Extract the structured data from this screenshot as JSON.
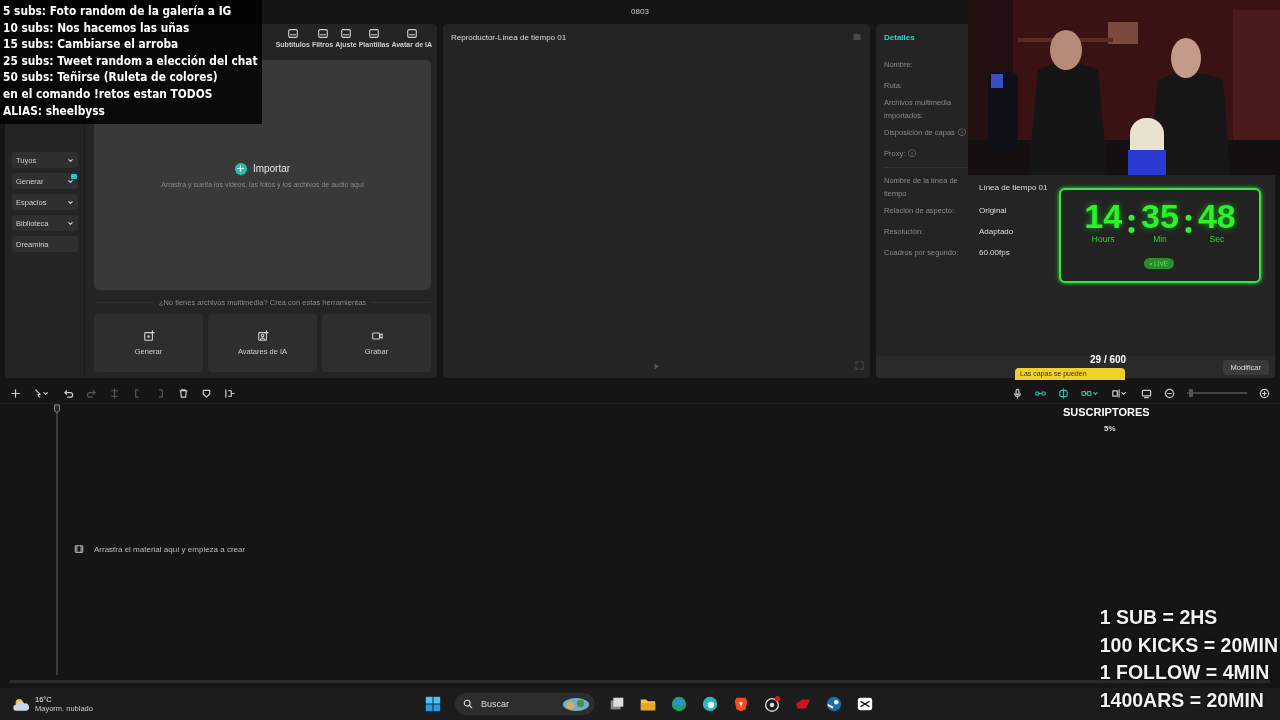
{
  "window": {
    "title": "0803"
  },
  "goals_overlay": {
    "lines": [
      "5 subs: Foto random de la galería a IG",
      "10 subs: Nos hacemos las uñas",
      "15 subs: Cambiarse el arroba",
      "25 subs: Tweet random a elección del chat",
      "50 subs: Teñirse (Ruleta de colores)",
      "en el comando !retos estan TODOS",
      "ALIAS: sheelbyss"
    ]
  },
  "media_panel": {
    "tabs": [
      {
        "label": "Subtítulos",
        "selected": false
      },
      {
        "label": "Filtros",
        "selected": false
      },
      {
        "label": "Ajuste",
        "selected": false
      },
      {
        "label": "Plantillas",
        "selected": false
      },
      {
        "label": "Avatar de IA",
        "selected": false
      }
    ],
    "sidebar": [
      {
        "label": "Tuyos",
        "expandable": true,
        "badge": false
      },
      {
        "label": "Generar",
        "expandable": true,
        "badge": true
      },
      {
        "label": "Espacios",
        "expandable": true,
        "badge": false
      },
      {
        "label": "Biblioteca",
        "expandable": true,
        "badge": false
      },
      {
        "label": "Dreamina",
        "expandable": false,
        "badge": false
      }
    ],
    "import": {
      "label": "Importar",
      "hint": "Arrastra y suelta los videos, las fotos y los archivos de audio aquí"
    },
    "tools_caption": "¿No tienes archivos multimedia? Crea con estas herramientas",
    "tools": [
      {
        "kind": "generate",
        "label": "Generar"
      },
      {
        "kind": "avatar",
        "label": "Avatares de IA"
      },
      {
        "kind": "record",
        "label": "Grabar"
      }
    ]
  },
  "player": {
    "title": "Reproductor-Línea de tiempo 01"
  },
  "details": {
    "title": "Detalles",
    "fields": [
      {
        "label": "Nombre:"
      },
      {
        "label": "Ruta:"
      },
      {
        "label": "Archivos multimedia importados:"
      },
      {
        "label": "Disposición de capas",
        "icon": "ⓘ"
      },
      {
        "label": "Proxy:",
        "icon": "ⓘ"
      }
    ],
    "timeline_fields": [
      {
        "label": "Nombre de la línea de tiempo",
        "value": "Línea de tiempo 01"
      },
      {
        "label": "Relación de aspecto:",
        "value": "Original"
      },
      {
        "label": "Resolución:",
        "value": "Adaptado"
      },
      {
        "label": "Cuadros por segundo:",
        "value": "60.00fps"
      }
    ],
    "button": "Modificar"
  },
  "timer": {
    "hours": "14",
    "minutes": "35",
    "seconds": "48",
    "hours_label": "Hours",
    "minutes_label": "Min",
    "seconds_label": "Sec",
    "live": "• LIVE"
  },
  "sub_goal": {
    "count": "29 / 600",
    "title": "SUSCRIPTORES",
    "percent": "5%"
  },
  "tooltip": "Las capas se pueden",
  "timeline": {
    "placeholder": "Arrastra el material aquí y empieza a crear",
    "zoom": {
      "level": 0.03
    }
  },
  "rates_overlay": {
    "lines": [
      "1 SUB = 2HS",
      "100 KICKS = 20MIN",
      "1 FOLLOW = 4MIN",
      "1400ARS = 20MIN"
    ]
  },
  "taskbar": {
    "weather": {
      "temperature": "16°C",
      "condition": "Mayorm. nublado"
    },
    "search": {
      "placeholder": "Buscar"
    }
  }
}
